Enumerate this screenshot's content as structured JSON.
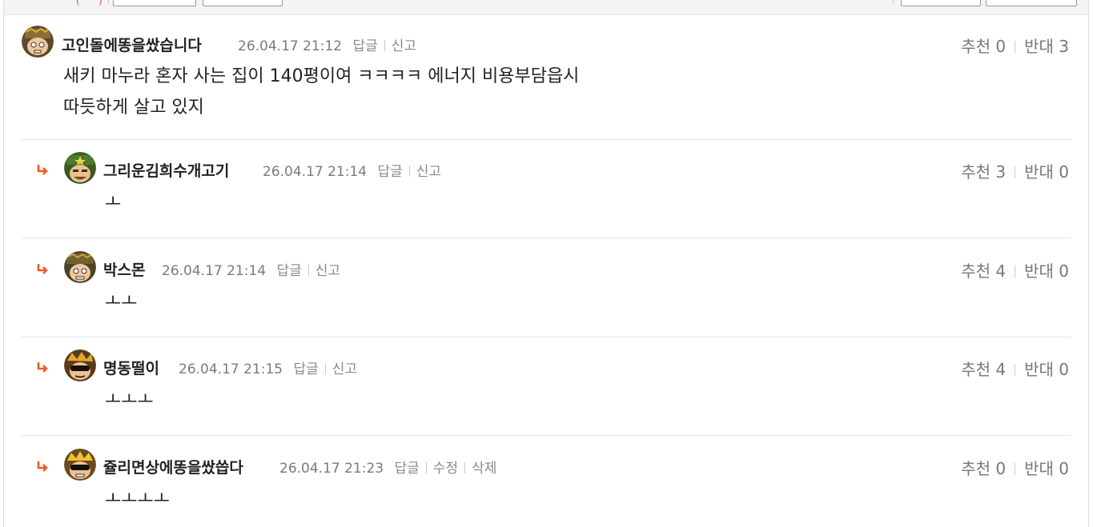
{
  "colors": {
    "accent": "#ee5a24",
    "meta": "#7a7a7a",
    "divider": "#e4e4e4"
  },
  "comments": [
    {
      "nick": "고인돌에똥을쌌습니다",
      "date": "26.04.17 21:12",
      "actions": [
        "답글",
        "신고"
      ],
      "recommend_label": "추천",
      "recommend": "0",
      "oppose_label": "반대",
      "oppose": "3",
      "lines": [
        "새키 마누라 혼자 사는 집이 140평이여 ㅋㅋㅋㅋ 에너지 비용부담읍시",
        "따듯하게 살고 있지"
      ],
      "avatar_icon": "soldier-avatar-icon"
    },
    {
      "nick": "그리운김희수개고기",
      "date": "26.04.17 21:14",
      "actions": [
        "답글",
        "신고"
      ],
      "recommend_label": "추천",
      "recommend": "3",
      "oppose_label": "반대",
      "oppose": "0",
      "lines": [
        "ㅗ"
      ],
      "avatar_icon": "general-avatar-icon"
    },
    {
      "nick": "박스몬",
      "date": "26.04.17 21:14",
      "actions": [
        "답글",
        "신고"
      ],
      "recommend_label": "추천",
      "recommend": "4",
      "oppose_label": "반대",
      "oppose": "0",
      "lines": [
        "ㅗㅗ"
      ],
      "avatar_icon": "soldier-avatar-icon"
    },
    {
      "nick": "명동떨이",
      "date": "26.04.17 21:15",
      "actions": [
        "답글",
        "신고"
      ],
      "recommend_label": "추천",
      "recommend": "4",
      "oppose_label": "반대",
      "oppose": "0",
      "lines": [
        "ㅗㅗㅗ"
      ],
      "avatar_icon": "sunglasses-avatar-icon"
    },
    {
      "nick": "쥴리면상에똥을쌌씁다",
      "date": "26.04.17 21:23",
      "actions": [
        "답글",
        "수정",
        "삭제"
      ],
      "recommend_label": "추천",
      "recommend": "0",
      "oppose_label": "반대",
      "oppose": "0",
      "lines": [
        "ㅗㅗㅗㅗ"
      ],
      "avatar_icon": "sunglasses-avatar-icon"
    }
  ]
}
